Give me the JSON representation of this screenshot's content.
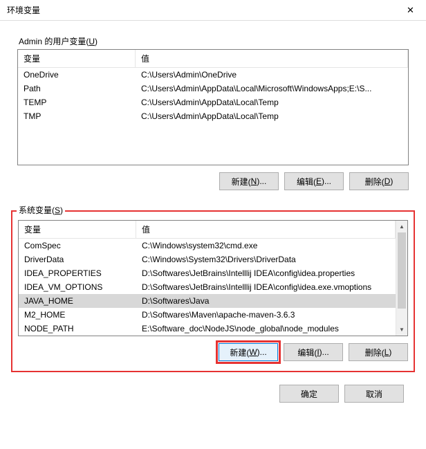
{
  "title": "环境变量",
  "userSection": {
    "label": "Admin 的用户变量(",
    "mnemonic": "U",
    "labelEnd": ")",
    "headers": {
      "name": "变量",
      "value": "值"
    },
    "rows": [
      {
        "name": "OneDrive",
        "value": "C:\\Users\\Admin\\OneDrive"
      },
      {
        "name": "Path",
        "value": "C:\\Users\\Admin\\AppData\\Local\\Microsoft\\WindowsApps;E:\\S..."
      },
      {
        "name": "TEMP",
        "value": "C:\\Users\\Admin\\AppData\\Local\\Temp"
      },
      {
        "name": "TMP",
        "value": "C:\\Users\\Admin\\AppData\\Local\\Temp"
      }
    ],
    "buttons": {
      "new": {
        "pre": "新建(",
        "m": "N",
        "post": ")..."
      },
      "edit": {
        "pre": "编辑(",
        "m": "E",
        "post": ")..."
      },
      "delete": {
        "pre": "删除(",
        "m": "D",
        "post": ")"
      }
    }
  },
  "sysSection": {
    "label": "系统变量(",
    "mnemonic": "S",
    "labelEnd": ")",
    "headers": {
      "name": "变量",
      "value": "值"
    },
    "rows": [
      {
        "name": "ComSpec",
        "value": "C:\\Windows\\system32\\cmd.exe"
      },
      {
        "name": "DriverData",
        "value": "C:\\Windows\\System32\\Drivers\\DriverData"
      },
      {
        "name": "IDEA_PROPERTIES",
        "value": "D:\\Softwares\\JetBrains\\Intelllij IDEA\\config\\idea.properties"
      },
      {
        "name": "IDEA_VM_OPTIONS",
        "value": "D:\\Softwares\\JetBrains\\Intelllij IDEA\\config\\idea.exe.vmoptions"
      },
      {
        "name": "JAVA_HOME",
        "value": "D:\\Softwares\\Java",
        "selected": true
      },
      {
        "name": "M2_HOME",
        "value": "D:\\Softwares\\Maven\\apache-maven-3.6.3"
      },
      {
        "name": "NODE_PATH",
        "value": "E:\\Software_doc\\NodeJS\\node_global\\node_modules"
      }
    ],
    "buttons": {
      "new": {
        "pre": "新建(",
        "m": "W",
        "post": ")..."
      },
      "edit": {
        "pre": "编辑(",
        "m": "I",
        "post": ")..."
      },
      "delete": {
        "pre": "删除(",
        "m": "L",
        "post": ")"
      }
    }
  },
  "dialogButtons": {
    "ok": "确定",
    "cancel": "取消"
  }
}
